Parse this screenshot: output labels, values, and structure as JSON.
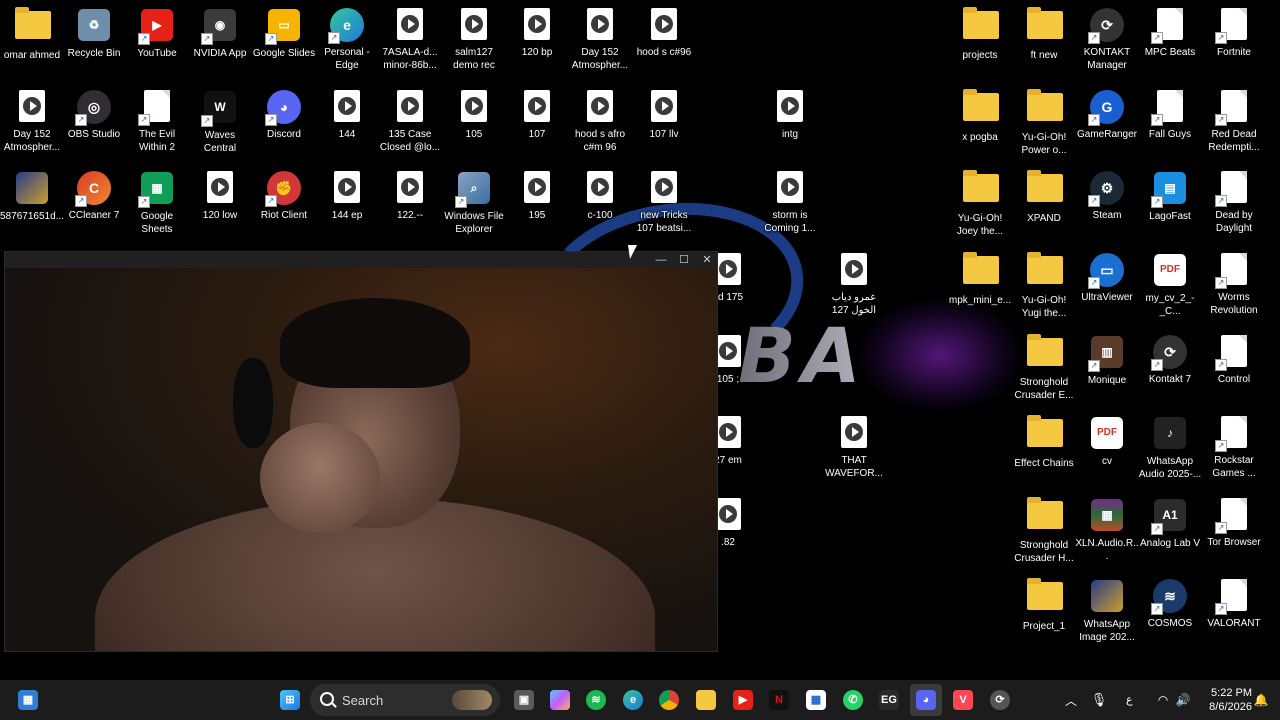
{
  "desktop": {
    "icons": [
      {
        "label": "omar ahmed",
        "icon": "folder-user-icon"
      },
      {
        "label": "Recycle Bin",
        "icon": "recycle-bin-icon"
      },
      {
        "label": "YouTube",
        "icon": "youtube-icon"
      },
      {
        "label": "NVIDIA App",
        "icon": "nvidia-icon"
      },
      {
        "label": "Google Slides",
        "icon": "google-slides-icon"
      },
      {
        "label": "Personal - Edge",
        "icon": "edge-icon"
      },
      {
        "label": "7ASALA-d... minor-86b...",
        "icon": "media-file-icon"
      },
      {
        "label": "salm127 demo rec",
        "icon": "media-file-icon"
      },
      {
        "label": "120 bp",
        "icon": "media-file-icon"
      },
      {
        "label": "Day 152 Atmospher...",
        "icon": "media-file-icon"
      },
      {
        "label": "hood s c#96",
        "icon": "media-file-icon"
      },
      {
        "label": "Day 152 Atmospher...",
        "icon": "media-file-icon"
      },
      {
        "label": "OBS Studio",
        "icon": "obs-icon"
      },
      {
        "label": "The Evil Within 2",
        "icon": "file-icon"
      },
      {
        "label": "Waves Central",
        "icon": "waves-icon"
      },
      {
        "label": "Discord",
        "icon": "discord-icon"
      },
      {
        "label": "144",
        "icon": "media-file-icon"
      },
      {
        "label": "135 Case Closed @lo...",
        "icon": "media-file-icon"
      },
      {
        "label": "105",
        "icon": "media-file-icon"
      },
      {
        "label": "107",
        "icon": "media-file-icon"
      },
      {
        "label": "hood s afro c#m 96",
        "icon": "media-file-icon"
      },
      {
        "label": "107 llv",
        "icon": "media-file-icon"
      },
      {
        "label": "intg",
        "icon": "media-file-icon"
      },
      {
        "label": "587671651d...",
        "icon": "image-icon"
      },
      {
        "label": "CCleaner 7",
        "icon": "ccleaner-icon"
      },
      {
        "label": "Google Sheets",
        "icon": "google-sheets-icon"
      },
      {
        "label": "120 low",
        "icon": "media-file-icon"
      },
      {
        "label": "Riot Client",
        "icon": "riot-icon"
      },
      {
        "label": "144 ep",
        "icon": "media-file-icon"
      },
      {
        "label": "122.--",
        "icon": "media-file-icon"
      },
      {
        "label": "Windows File Explorer",
        "icon": "file-explorer-icon"
      },
      {
        "label": "195",
        "icon": "media-file-icon"
      },
      {
        "label": "c-100",
        "icon": "media-file-icon"
      },
      {
        "label": "new Tricks 107 beatsi...",
        "icon": "media-file-icon"
      },
      {
        "label": "storm is Coming 1...",
        "icon": "media-file-icon"
      },
      {
        "label": "sd 175",
        "icon": "media-file-icon"
      },
      {
        "label": "عمرو دياب الخول 127",
        "icon": "media-file-icon"
      },
      {
        "label": "105 ;",
        "icon": "media-file-icon"
      },
      {
        "label": "27 em",
        "icon": "media-file-icon"
      },
      {
        "label": "THAT WAVEFOR...",
        "icon": "media-file-icon"
      },
      {
        "label": ".82",
        "icon": "media-file-icon"
      },
      {
        "label": "projects",
        "icon": "folder-icon"
      },
      {
        "label": "ft new",
        "icon": "folder-icon"
      },
      {
        "label": "KONTAKT Manager",
        "icon": "kontakt-icon"
      },
      {
        "label": "MPC Beats",
        "icon": "file-icon"
      },
      {
        "label": "Fortnite",
        "icon": "file-icon"
      },
      {
        "label": "x pogba",
        "icon": "zip-folder-icon"
      },
      {
        "label": "Yu-Gi-Oh! Power o...",
        "icon": "folder-icon"
      },
      {
        "label": "GameRanger",
        "icon": "gameranger-icon"
      },
      {
        "label": "Fall Guys",
        "icon": "file-icon"
      },
      {
        "label": "Red Dead Redempti...",
        "icon": "file-icon"
      },
      {
        "label": "Yu-Gi-Oh! Joey the...",
        "icon": "folder-icon"
      },
      {
        "label": "XPAND",
        "icon": "folder-icon"
      },
      {
        "label": "Steam",
        "icon": "steam-icon"
      },
      {
        "label": "LagoFast",
        "icon": "lagofast-icon"
      },
      {
        "label": "Dead by Daylight",
        "icon": "file-icon"
      },
      {
        "label": "mpk_mini_e...",
        "icon": "folder-icon"
      },
      {
        "label": "Yu-Gi-Oh! Yugi the...",
        "icon": "folder-icon"
      },
      {
        "label": "UltraViewer",
        "icon": "ultraviewer-icon"
      },
      {
        "label": "my_cv_2_-_C...",
        "icon": "pdf-icon"
      },
      {
        "label": "Worms Revolution",
        "icon": "file-icon"
      },
      {
        "label": "Stronghold Crusader E...",
        "icon": "folder-icon"
      },
      {
        "label": "Monique",
        "icon": "monique-icon"
      },
      {
        "label": "Kontakt 7",
        "icon": "kontakt-icon"
      },
      {
        "label": "Control",
        "icon": "file-icon"
      },
      {
        "label": "Effect Chains",
        "icon": "folder-icon"
      },
      {
        "label": "cv",
        "icon": "pdf-icon"
      },
      {
        "label": "WhatsApp Audio 2025-...",
        "icon": "audio-file-icon"
      },
      {
        "label": "Rockstar Games ...",
        "icon": "file-icon"
      },
      {
        "label": "Stronghold Crusader H...",
        "icon": "folder-icon"
      },
      {
        "label": "XLN.Audio.R...",
        "icon": "winrar-icon"
      },
      {
        "label": "Analog Lab V",
        "icon": "analog-lab-icon"
      },
      {
        "label": "Tor Browser",
        "icon": "file-icon"
      },
      {
        "label": "Project_1",
        "icon": "folder-icon"
      },
      {
        "label": "WhatsApp Image 202...",
        "icon": "image-icon"
      },
      {
        "label": "COSMOS",
        "icon": "cosmos-icon"
      },
      {
        "label": "VALORANT",
        "icon": "file-icon"
      }
    ],
    "wallpaper_text": "BA"
  },
  "window": {
    "controls": [
      "minimize-icon",
      "maximize-icon",
      "close-icon"
    ]
  },
  "taskbar": {
    "search_placeholder": "Search",
    "apps": [
      "start-icon",
      "task-view-icon",
      "copilot-icon",
      "spotify-icon",
      "edge-icon",
      "chrome-icon",
      "file-explorer-icon",
      "youtube-icon",
      "netflix-icon",
      "store-icon",
      "whatsapp-icon",
      "epic-games-icon",
      "discord-icon",
      "valorant-icon",
      "riot-icon"
    ],
    "tray": {
      "ime": "ع",
      "time": "5:22 PM",
      "date": "8/6/2026"
    }
  },
  "colors": {
    "taskbar_bg": "#1c1c1c",
    "folder": "#f5c842",
    "accent": "#1a5fd1",
    "wallpaper_purple": "#8a35e0"
  }
}
